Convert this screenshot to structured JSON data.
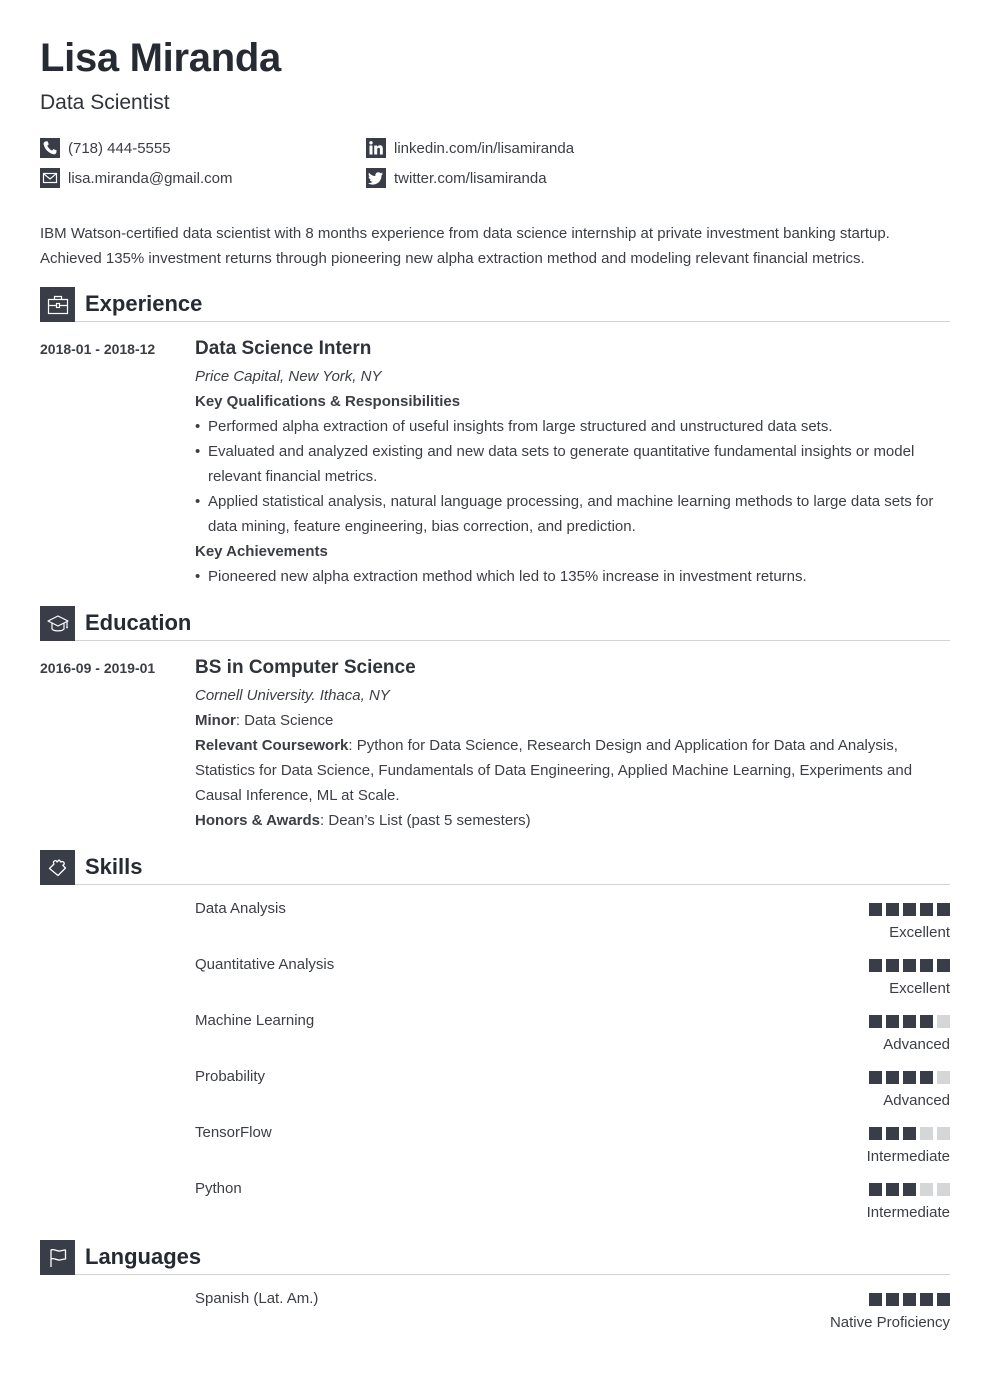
{
  "header": {
    "name": "Lisa Miranda",
    "title": "Data Scientist"
  },
  "contacts": [
    {
      "icon": "phone-icon",
      "text": "(718) 444-5555"
    },
    {
      "icon": "email-icon",
      "text": "lisa.miranda@gmail.com"
    },
    {
      "icon": "linkedin-icon",
      "text": "linkedin.com/in/lisamiranda"
    },
    {
      "icon": "twitter-icon",
      "text": "twitter.com/lisamiranda"
    }
  ],
  "summary": "IBM Watson-certified data scientist with 8 months experience from data science internship at private investment banking startup. Achieved 135% investment returns through pioneering new alpha extraction method and modeling relevant financial metrics.",
  "sections": {
    "experience": {
      "title": "Experience",
      "icon": "briefcase-icon"
    },
    "education": {
      "title": "Education",
      "icon": "graduation-cap-icon"
    },
    "skills": {
      "title": "Skills",
      "icon": "puzzle-piece-icon"
    },
    "languages": {
      "title": "Languages",
      "icon": "flag-icon"
    }
  },
  "experience": [
    {
      "dates": "2018-01 - 2018-12",
      "role": "Data Science Intern",
      "company": "Price Capital, New York, NY",
      "qualifications_heading": "Key Qualifications & Responsibilities",
      "bullet_char": "•",
      "qualifications": [
        "Performed alpha extraction of useful insights from large structured and unstructured data sets.",
        "Evaluated and analyzed existing and new data sets to generate quantitative fundamental insights or model relevant financial metrics.",
        "Applied statistical analysis, natural language processing, and machine learning methods to large data sets for data mining, feature engineering, bias correction, and prediction."
      ],
      "achievements_heading": "Key Achievements",
      "achievements": [
        "Pioneered new alpha extraction method which led to 135% increase in investment returns."
      ]
    }
  ],
  "education": [
    {
      "dates": "2016-09 - 2019-01",
      "degree": "BS in Computer Science",
      "school": "Cornell University. Ithaca, NY",
      "minor_label": "Minor",
      "minor": ": Data Science",
      "coursework_label": "Relevant Coursework",
      "coursework": ": Python for Data Science, Research Design and Application for Data and Analysis, Statistics for Data Science, Fundamentals of Data Engineering, Applied Machine Learning, Experiments and Causal Inference, ML at Scale.",
      "honors_label": "Honors & Awards",
      "honors": ": Dean’s List (past 5 semesters)"
    }
  ],
  "skills": [
    {
      "name": "Data Analysis",
      "level": "Excellent",
      "rating": 5,
      "max": 5
    },
    {
      "name": "Quantitative Analysis",
      "level": "Excellent",
      "rating": 5,
      "max": 5
    },
    {
      "name": "Machine Learning",
      "level": "Advanced",
      "rating": 4,
      "max": 5
    },
    {
      "name": "Probability",
      "level": "Advanced",
      "rating": 4,
      "max": 5
    },
    {
      "name": "TensorFlow",
      "level": "Intermediate",
      "rating": 3,
      "max": 5
    },
    {
      "name": "Python",
      "level": "Intermediate",
      "rating": 3,
      "max": 5
    }
  ],
  "languages": [
    {
      "name": "Spanish (Lat. Am.)",
      "level": "Native Proficiency",
      "rating": 5,
      "max": 5
    }
  ],
  "colors": {
    "icon_bg": "#383d48",
    "dot_filled": "#383d48",
    "dot_empty": "#d5d6d7",
    "divider": "#d2d3d5",
    "heading": "#262a33",
    "text": "#3b3e44"
  }
}
